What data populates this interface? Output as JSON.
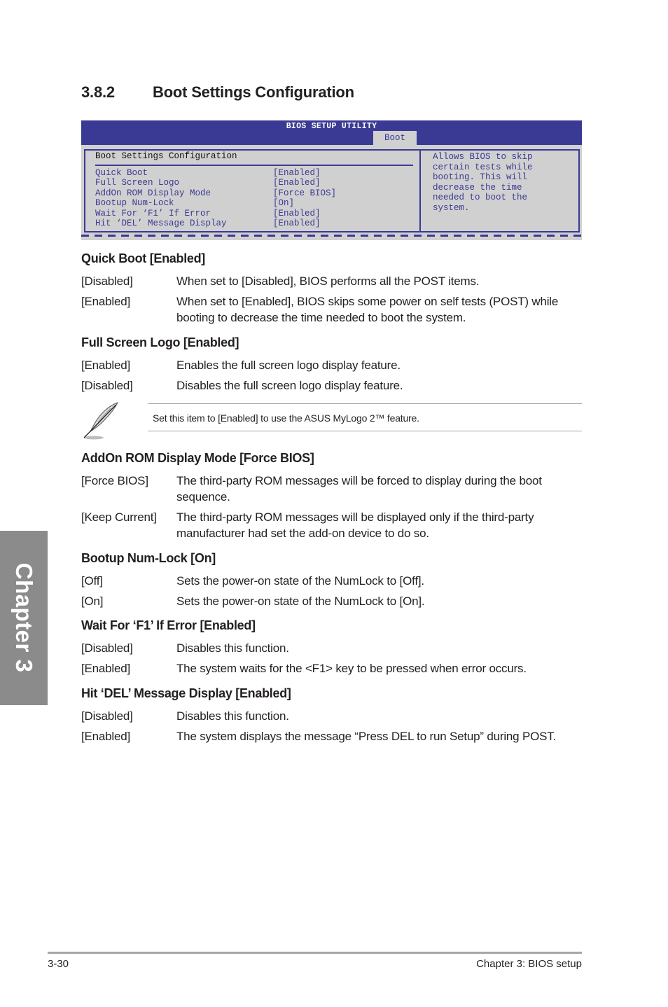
{
  "section": {
    "number": "3.8.2",
    "title": "Boot Settings Configuration"
  },
  "bios": {
    "title": "BIOS SETUP UTILITY",
    "active_tab": "Boot",
    "panel_title": "Boot Settings Configuration",
    "items": [
      {
        "label": "Quick Boot",
        "value": "[Enabled]"
      },
      {
        "label": "Full Screen Logo",
        "value": "[Enabled]"
      },
      {
        "label": "AddOn ROM Display Mode",
        "value": "[Force BIOS]"
      },
      {
        "label": "Bootup Num-Lock",
        "value": "[On]"
      },
      {
        "label": "Wait For ‘F1’ If Error",
        "value": "[Enabled]"
      },
      {
        "label": "Hit ‘DEL’ Message Display",
        "value": "[Enabled]"
      }
    ],
    "help_text": "Allows BIOS to skip\ncertain tests while\nbooting. This will\ndecrease the time\nneeded to boot the\nsystem.",
    "colors": {
      "header": "#3a3a94",
      "body": "#d0d0d0",
      "text": "#3a3a94"
    }
  },
  "items": [
    {
      "title": "Quick Boot [Enabled]",
      "options": [
        {
          "key": "[Disabled]",
          "desc": "When set to [Disabled], BIOS performs all the POST items."
        },
        {
          "key": "[Enabled]",
          "desc": "When set to [Enabled], BIOS skips some power on self tests (POST) while booting to decrease the time needed to boot the system."
        }
      ]
    },
    {
      "title": "Full Screen Logo [Enabled]",
      "options": [
        {
          "key": "[Enabled]",
          "desc": "Enables the full screen logo display feature."
        },
        {
          "key": "[Disabled]",
          "desc": "Disables the full screen logo display feature."
        }
      ]
    },
    {
      "title": "AddOn ROM Display Mode [Force BIOS]",
      "options": [
        {
          "key": "[Force BIOS]",
          "desc": "The third-party ROM messages will be forced to display during the boot sequence."
        },
        {
          "key": "[Keep Current]",
          "desc": "The third-party ROM messages will be displayed only if the third-party manufacturer had set the add-on device to do so."
        }
      ]
    },
    {
      "title": "Bootup Num-Lock [On]",
      "options": [
        {
          "key": "[Off]",
          "desc": "Sets the power-on state of the NumLock to [Off]."
        },
        {
          "key": "[On]",
          "desc": "Sets the power-on state of the NumLock to [On]."
        }
      ]
    },
    {
      "title": "Wait For ‘F1’ If Error [Enabled]",
      "options": [
        {
          "key": "[Disabled]",
          "desc": "Disables this function."
        },
        {
          "key": "[Enabled]",
          "desc": "The system waits for the <F1> key to be pressed when error occurs."
        }
      ]
    },
    {
      "title": "Hit ‘DEL’ Message Display [Enabled]",
      "options": [
        {
          "key": "[Disabled]",
          "desc": "Disables this function."
        },
        {
          "key": "[Enabled]",
          "desc": "The system displays the message “Press DEL to run Setup” during POST."
        }
      ]
    }
  ],
  "note": {
    "icon": "feather-pen-icon",
    "text": "Set this item to [Enabled] to use the ASUS MyLogo 2™ feature."
  },
  "chapter_tab": {
    "label": "Chapter 3",
    "color": "#8c8b8b"
  },
  "footer": {
    "page_number": "3-30",
    "chapter": "Chapter 3: BIOS setup"
  }
}
